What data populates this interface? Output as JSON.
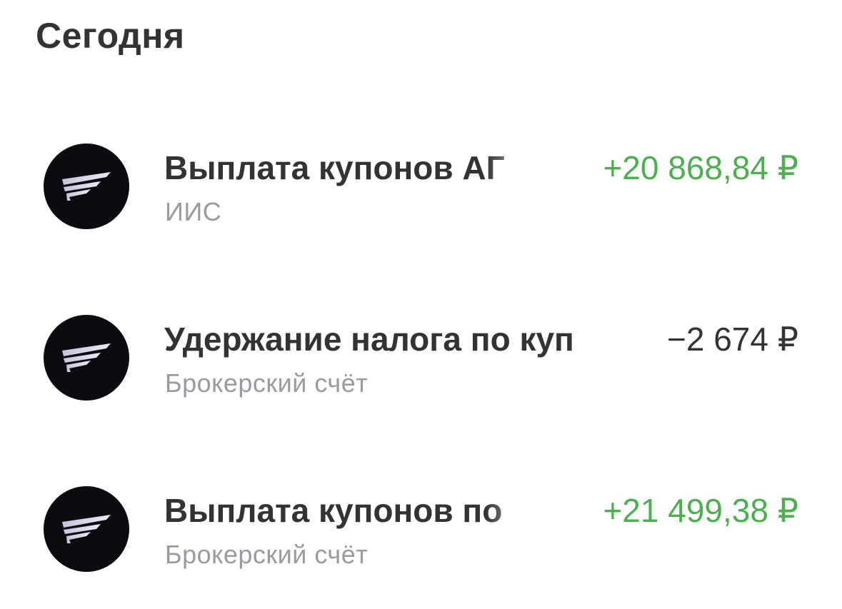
{
  "section": {
    "title": "Сегодня"
  },
  "operations": [
    {
      "title": "Выплата купонов АГ",
      "account": "ИИС",
      "amount": "+20 868,84 ₽",
      "direction": "positive",
      "icon": "wing-logo-icon"
    },
    {
      "title": "Удержание налога по куп",
      "account": "Брокерский счёт",
      "amount": "−2 674 ₽",
      "direction": "negative",
      "icon": "wing-logo-icon"
    },
    {
      "title": "Выплата купонов по",
      "account": "Брокерский счёт",
      "amount": "+21 499,38 ₽",
      "direction": "positive",
      "icon": "wing-logo-icon"
    }
  ],
  "colors": {
    "text_primary": "#333333",
    "text_secondary": "#9a9aa2",
    "amount_positive": "#4caf50",
    "avatar_background": "#0c0c10"
  }
}
